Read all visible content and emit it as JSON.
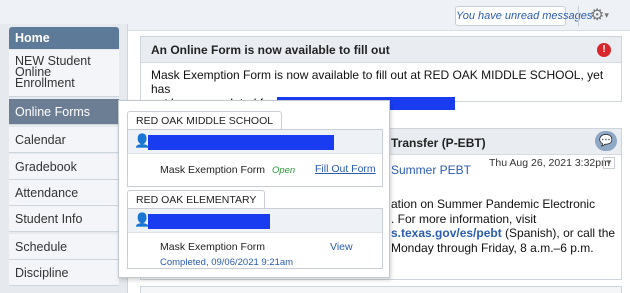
{
  "topbar": {
    "unread_label": "You have unread messages",
    "settings_caret": "▾"
  },
  "sidebar": {
    "items": [
      {
        "label": "Home"
      },
      {
        "label_lines": [
          "NEW Student",
          "Online",
          "Enrollment"
        ]
      },
      {
        "label": "Online Forms"
      },
      {
        "label": "Calendar"
      },
      {
        "label": "Gradebook"
      },
      {
        "label": "Attendance"
      },
      {
        "label": "Student Info"
      },
      {
        "label": "Schedule"
      },
      {
        "label": "Discipline"
      }
    ]
  },
  "notification": {
    "title": "An Online Form is now available to fill out",
    "message_line1": "Mask Exemption Form is now available to fill out at RED OAK MIDDLE SCHOOL, yet has",
    "message_line2_prefix": "not been completed for",
    "alert_icon_glyph": "!"
  },
  "pebt": {
    "title": "Transfer (P-EBT)",
    "link": "Summer PEBT",
    "date": "Thu Aug 26, 2021 3:32pm",
    "text_lines": [
      "ation on Summer Pandemic Electronic",
      ".  For more information, visit",
      "s.texas.gov/es/pebt",
      " (Spanish), or call the",
      "Monday through Friday, 8 a.m.–6 p.m."
    ]
  },
  "popup": {
    "schools": [
      {
        "name": "RED OAK MIDDLE SCHOOL",
        "form_name": "Mask Exemption Form",
        "status": "Open",
        "action": "Fill Out Form"
      },
      {
        "name": "RED OAK ELEMENTARY",
        "form_name": "Mask Exemption Form",
        "action": "View",
        "completed": "Completed, 09/06/2021 9:21am"
      }
    ]
  },
  "colors": {
    "redaction": "#1a3cf0",
    "nav_active": "#6c7e93",
    "nav_home": "#5d7a99",
    "link": "#2a5db0",
    "open_status": "#2a9a3a",
    "alert": "#d9262c"
  }
}
